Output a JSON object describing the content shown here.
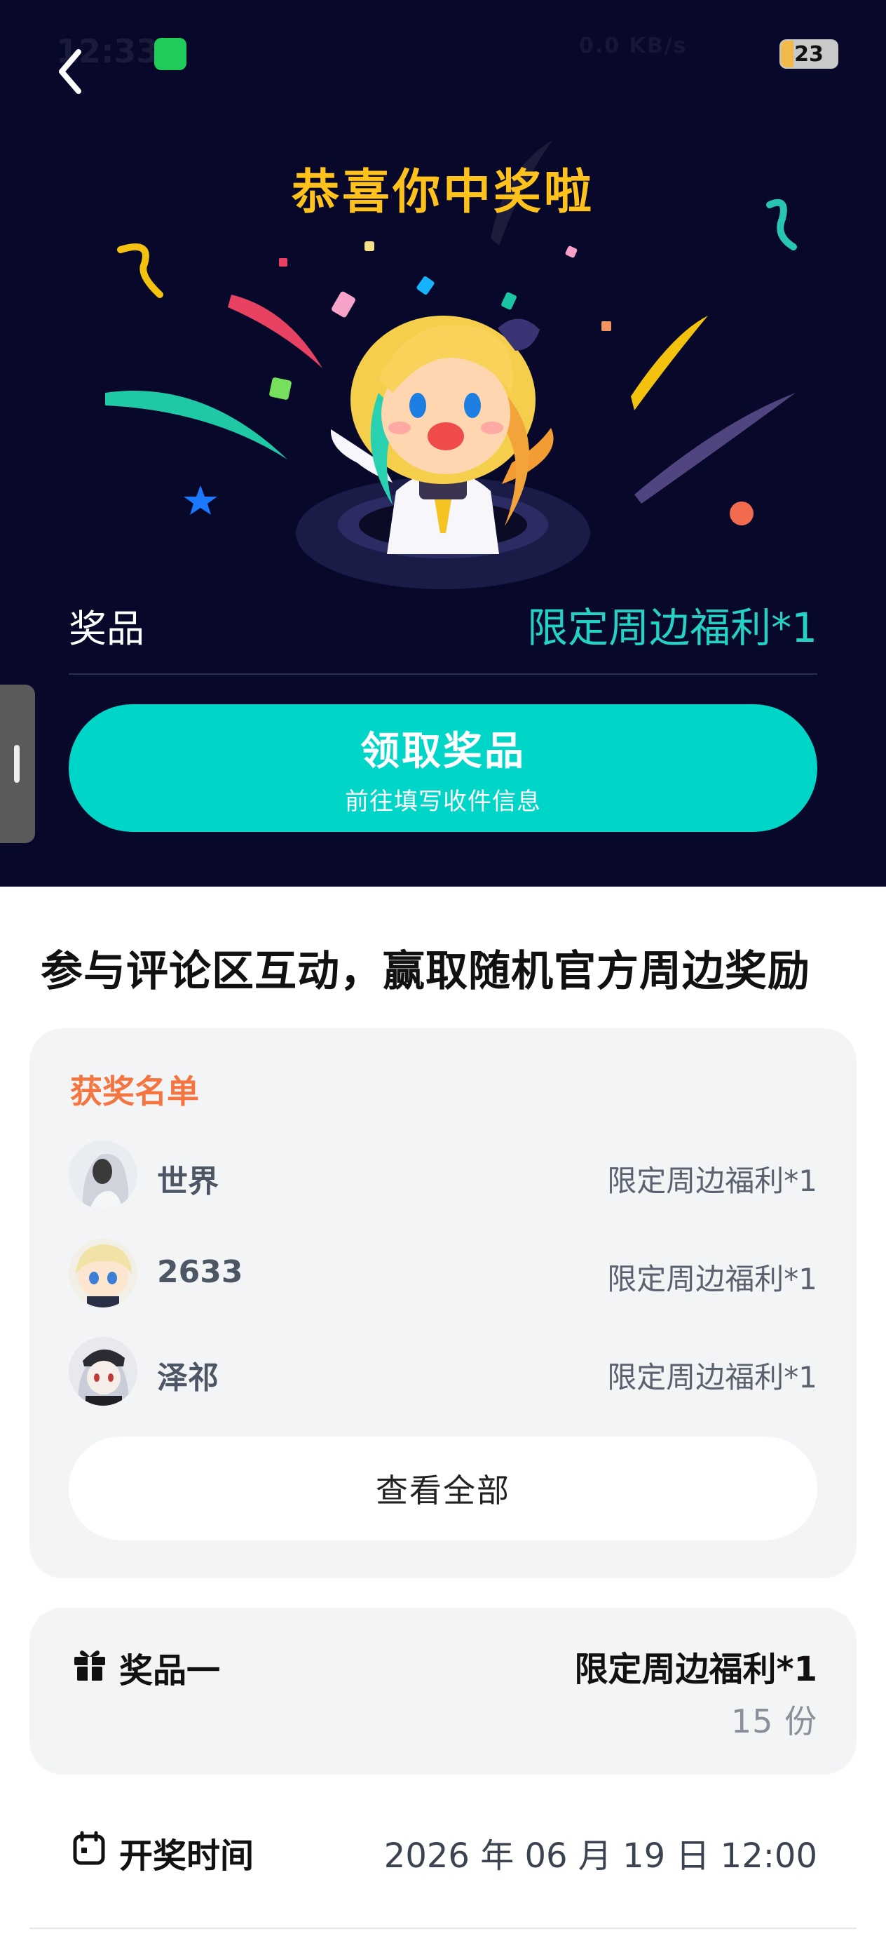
{
  "status_bar": {
    "time": "12:33",
    "network": "0.0 KB/s",
    "battery": "23"
  },
  "hero": {
    "title": "恭喜你中奖啦",
    "prize_label": "奖品",
    "prize_value": "限定周边福利*1",
    "claim_button": {
      "label": "领取奖品",
      "sublabel": "前往填写收件信息"
    }
  },
  "section_title": "参与评论区互动，赢取随机官方周边奖励",
  "winners": {
    "heading": "获奖名单",
    "rows": [
      {
        "name": "世界",
        "prize": "限定周边福利*1"
      },
      {
        "name": "2633",
        "prize": "限定周边福利*1"
      },
      {
        "name": "泽祁",
        "prize": "限定周边福利*1"
      }
    ],
    "view_all": "查看全部"
  },
  "prize_info": {
    "label": "奖品一",
    "value": "限定周边福利*1",
    "count": "15 份"
  },
  "draw_time": {
    "label": "开奖时间",
    "value": "2026 年 06 月 19 日 12:00"
  },
  "colors": {
    "hero_background": "#07082a",
    "title_yellow": "#ffc21c",
    "accent_teal": "#00d6c8",
    "winners_orange": "#f4753f"
  },
  "icons": [
    "back-arrow-icon",
    "wechat-icon",
    "gift-icon",
    "calendar-icon"
  ]
}
